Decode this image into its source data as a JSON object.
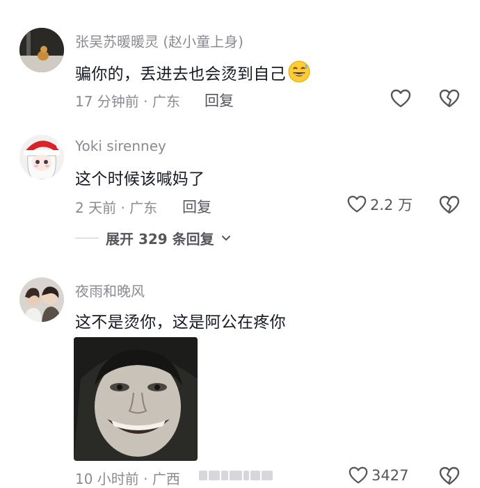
{
  "comments": [
    {
      "username": "张吴苏暖暖灵 (赵小童上身)",
      "text": "骗你的，丢进去也会烫到自己",
      "time_location": "17 分钟前 · 广东",
      "reply_label": "回复",
      "like_count": "",
      "avatar_icon": "cat-photo-avatar"
    },
    {
      "username": "Yoki sirenney",
      "text": "这个时候该喊妈了",
      "time_location": "2 天前 · 广东",
      "reply_label": "回复",
      "like_count": "2.2 万",
      "avatar_icon": "anime-girl-santa-hat-avatar",
      "expand_label": "展开 329 条回复"
    },
    {
      "username": "夜雨和晚风",
      "text": "这不是烫你，这是阿公在疼你",
      "time_location": "10 小时前 · 广西",
      "reply_label": "",
      "like_count": "3427",
      "avatar_icon": "couple-photo-avatar",
      "image_icon": "smiling-man-meme-image"
    }
  ],
  "colors": {
    "text": "#161823",
    "secondary": "#8a8b91",
    "action": "#55565c"
  }
}
